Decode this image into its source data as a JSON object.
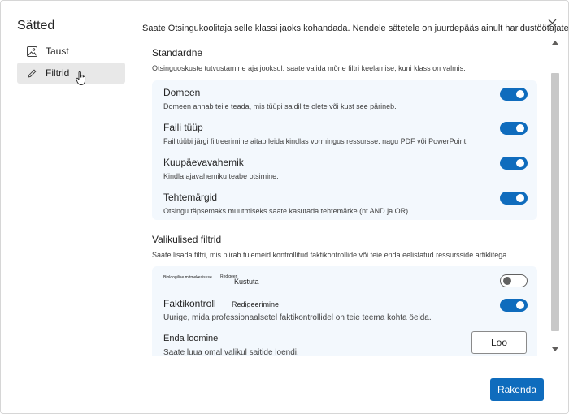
{
  "sidebar": {
    "title": "Sätted",
    "items": [
      {
        "label": "Taust",
        "icon": "image-icon"
      },
      {
        "label": "Filtrid",
        "icon": "pencil-icon"
      }
    ]
  },
  "header": {
    "intro": "Saate Otsingukoolitaja selle klassi jaoks kohandada. Nendele sätetele on juurdepääs ainult haridustöötajatel."
  },
  "standard": {
    "title": "Standardne",
    "subtitle": "Otsinguoskuste tutvustamine aja jooksul. saate valida mõne filtri keelamise, kuni klass on valmis.",
    "rows": [
      {
        "title": "Domeen",
        "desc": "Domeen annab teile teada, mis tüüpi saidil te olete või kust see pärineb.",
        "on": true
      },
      {
        "title": "Faili tüüp",
        "desc": "Failitüübi järgi filtreerimine aitab leida kindlas vormingus ressursse. nagu PDF või PowerPoint.",
        "on": true
      },
      {
        "title": "Kuupäevavahemik",
        "desc": "Kindla ajavahemiku teabe otsimine.",
        "on": true
      },
      {
        "title": "Tehtemärgid",
        "desc": "Otsingu täpsemaks muutmiseks saate kasutada tehtemärke (nt AND ja OR).",
        "on": true
      }
    ]
  },
  "optional": {
    "title": "Valikulised filtrid",
    "subtitle": "Saate lisada filtri, mis piirab tulemeid kontrollitud faktikontrollide või teie enda eelistatud ressursside artiklitega.",
    "custom_row": {
      "name": "Bioloogilise mitmekesisuse",
      "edit": "Redigeeri",
      "delete": "Kustuta",
      "on": false
    },
    "factcheck": {
      "title": "Faktikontroll",
      "edit": "Redigeerimine",
      "desc": "Uurige, mida professionaalsetel faktikontrollidel on teie teema kohta öelda.",
      "on": true
    },
    "create": {
      "title": "Enda loomine",
      "desc": "Saate luua omal valikul saitide loendi.",
      "button": "Loo"
    }
  },
  "footer": {
    "apply": "Rakenda"
  },
  "colors": {
    "accent": "#0f6cbd",
    "card_bg": "#f3f8fd"
  }
}
